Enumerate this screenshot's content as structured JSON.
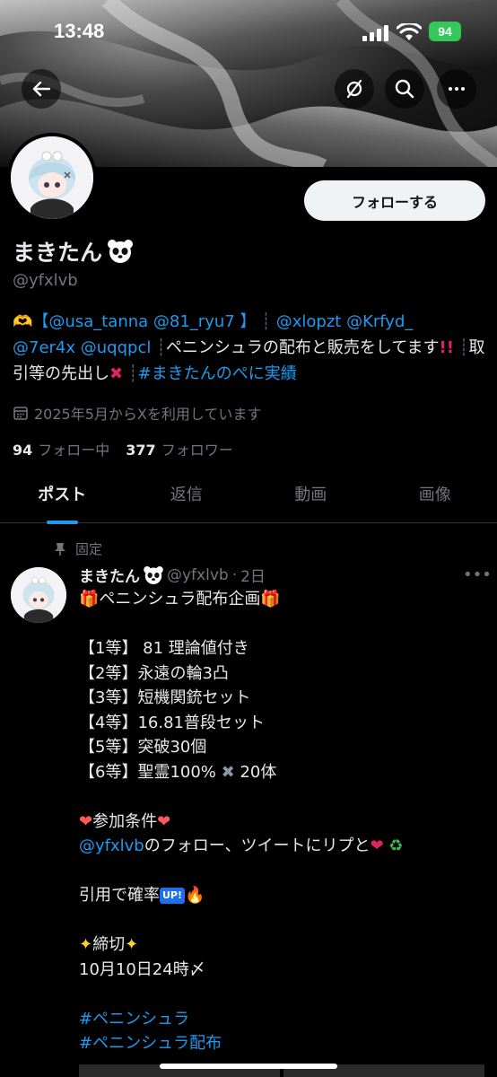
{
  "status_bar": {
    "time": "13:48",
    "battery": "94"
  },
  "header": {
    "back_icon": "back-arrow-icon",
    "hide_icon": "eye-off-icon",
    "search_icon": "search-icon",
    "more_icon": "more-icon"
  },
  "profile": {
    "display_name": "まきたん",
    "handle": "@yfxlvb",
    "follow_label": "フォローする",
    "bio": {
      "part1_link": "【@usa_tanna @81_ryu7 】",
      "part2_link": "@xlopzt @Krfyd_",
      "part3_link": "@7er4x @uqqpcl",
      "part4_text": "ペニンシュラの配布と販売をしてます",
      "part5_text": "取引等の先出し",
      "part6_link": "#まきたんのぺに実績"
    },
    "joined": "2025年5月からXを利用しています",
    "following_count": "94",
    "following_label": "フォロー中",
    "followers_count": "377",
    "followers_label": "フォロワー"
  },
  "tabs": [
    "ポスト",
    "返信",
    "動画",
    "画像"
  ],
  "post": {
    "pinned_label": "固定",
    "author_name": "まきたん",
    "author_handle": "@yfxlvb",
    "time": "2日",
    "title": "ペニンシュラ配布企画",
    "prizes": [
      "【1等】 81 理論値付き",
      "【2等】永遠の輪3凸",
      "【3等】短機関銃セット",
      "【4等】16.81普段セット",
      "【5等】突破30個",
      "【6等】聖霊100%"
    ],
    "prize6_suffix": "20体",
    "conditions_label": "参加条件",
    "conditions_mention": "@yfxlvb",
    "conditions_text": "のフォロー、ツイートにリプと",
    "quote_text": "引用で確率",
    "up_badge": "UP!",
    "deadline_label": "締切",
    "deadline_text": "10月10日24時〆",
    "hashtags": [
      "#ペニンシュラ",
      "#ペニンシュラ配布"
    ]
  }
}
